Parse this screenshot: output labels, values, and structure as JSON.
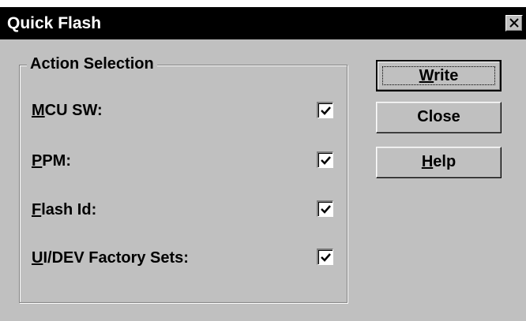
{
  "window": {
    "title": "Quick Flash",
    "close_glyph": "×"
  },
  "group": {
    "legend": "Action Selection",
    "items": [
      {
        "mnemonic": "M",
        "rest": "CU SW:",
        "checked": true
      },
      {
        "mnemonic": "P",
        "rest": "PM:",
        "checked": true
      },
      {
        "mnemonic": "F",
        "rest": "lash Id:",
        "checked": true
      },
      {
        "mnemonic": "U",
        "rest": "I/DEV Factory Sets:",
        "checked": true
      }
    ]
  },
  "buttons": {
    "write": {
      "mnemonic": "W",
      "rest": "rite"
    },
    "close": {
      "label": "Close"
    },
    "help": {
      "mnemonic": "H",
      "rest": "elp"
    }
  },
  "colors": {
    "face": "#c0c0c0",
    "titlebar": "#000000",
    "title_text": "#ffffff"
  }
}
